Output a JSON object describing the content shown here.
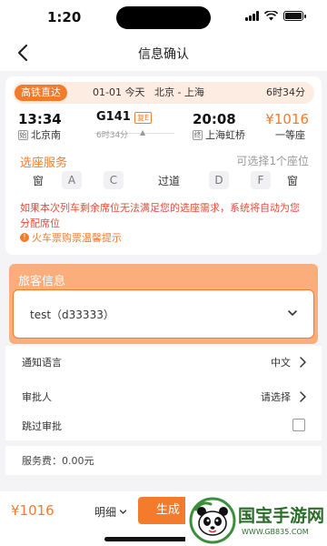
{
  "status_bar": {
    "time": "1:20"
  },
  "nav": {
    "title": "信息确认"
  },
  "trip": {
    "badge": "高铁直达",
    "date": "01-01 今天",
    "route": "北京 - 上海",
    "duration_total": "6时34分",
    "depart_time": "13:34",
    "train_no": "G141",
    "train_tag": "复E",
    "arrive_time": "20:08",
    "price": "¥1016",
    "depart_tag": "始",
    "depart_station": "北京南",
    "duration": "6时34分",
    "duration_caret": "▲",
    "arrive_tag": "终",
    "arrive_station": "上海虹桥",
    "seat_class": "一等座"
  },
  "seat_select": {
    "title": "选座服务",
    "hint": "可选择1个座位",
    "window_left": "窗",
    "seat_a": "A",
    "seat_c": "C",
    "aisle": "过道",
    "seat_d": "D",
    "seat_f": "F",
    "window_right": "窗",
    "note": "如果本次列车剩余席位无法满足您的选座需求，系统将自动为您分配席位",
    "tips_icon": "!",
    "tips": "火车票购票温馨提示"
  },
  "passenger": {
    "title": "旅客信息",
    "name": "test（d33333）"
  },
  "settings": {
    "notify_label": "通知语言",
    "notify_value": "中文",
    "approver_label": "审批人",
    "approver_value": "请选择",
    "skip_label": "跳过审批"
  },
  "fee": {
    "text": "服务费：0.00元"
  },
  "bottom": {
    "total": "¥1016",
    "detail": "明细",
    "submit": "生成"
  },
  "watermark": {
    "name": "国宝手游网",
    "url": "WWW.GB835.COM"
  },
  "colors": {
    "accent": "#f37b2b",
    "warning": "#e64b3b",
    "pax_header": "#fbad7c"
  },
  "icons": [
    "back-arrow-icon",
    "signal-icon",
    "wifi-icon",
    "battery-icon",
    "chevron-down-icon",
    "chevron-right-icon",
    "info-icon",
    "panda-logo-icon"
  ]
}
